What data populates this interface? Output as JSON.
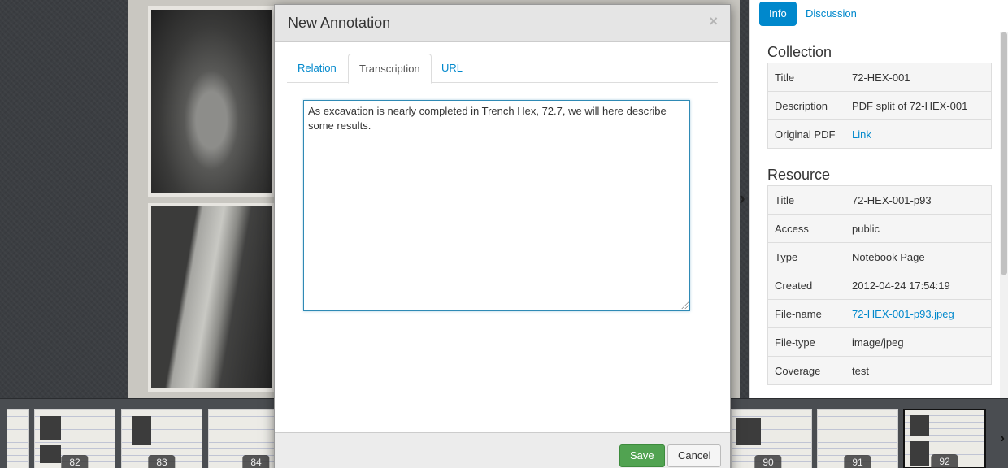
{
  "viewer": {
    "next_icon": "chevron-right-icon"
  },
  "filmstrip": {
    "thumbnails": [
      "82",
      "83",
      "84",
      "90",
      "91",
      "92"
    ],
    "next_icon": "chevron-right-icon"
  },
  "sidebar": {
    "tabs": [
      "Info",
      "Discussion"
    ],
    "active_tab": "Info",
    "collection": {
      "heading": "Collection",
      "rows": [
        {
          "key": "Title",
          "value": "72-HEX-001"
        },
        {
          "key": "Description",
          "value": "PDF split of 72-HEX-001"
        },
        {
          "key": "Original PDF",
          "value": "Link"
        }
      ]
    },
    "resource": {
      "heading": "Resource",
      "rows": [
        {
          "key": "Title",
          "value": "72-HEX-001-p93"
        },
        {
          "key": "Access",
          "value": "public"
        },
        {
          "key": "Type",
          "value": "Notebook Page"
        },
        {
          "key": "Created",
          "value": "2012-04-24 17:54:19"
        },
        {
          "key": "File-name",
          "value": "72-HEX-001-p93.jpeg"
        },
        {
          "key": "File-type",
          "value": "image/jpeg"
        },
        {
          "key": "Coverage",
          "value": "test"
        }
      ]
    }
  },
  "modal": {
    "title": "New Annotation",
    "close_label": "×",
    "tabs": [
      "Relation",
      "Transcription",
      "URL"
    ],
    "active_tab": "Transcription",
    "transcription_text": "As excavation is nearly completed in Trench Hex, 72.7, we will here describe some results.",
    "save_label": "Save",
    "cancel_label": "Cancel"
  },
  "colors": {
    "accent": "#0088cc",
    "save": "#51a351",
    "modal_header": "#e5e5e5"
  }
}
